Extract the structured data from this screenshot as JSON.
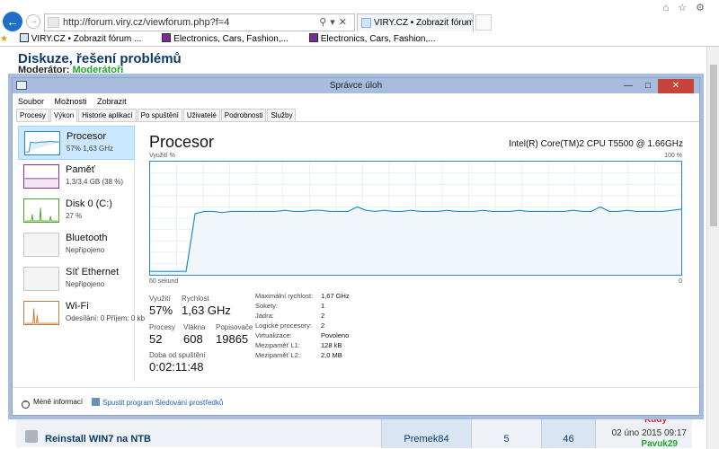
{
  "browser": {
    "url": "http://forum.viry.cz/viewforum.php?f=4",
    "tab_title": "VIRY.CZ • Zobrazit fórum - ...",
    "favorites": [
      "VIRY.CZ • Zobrazit fórum ...",
      "Electronics, Cars, Fashion,...",
      "Electronics, Cars, Fashion,..."
    ]
  },
  "forum": {
    "title": "Diskuze, řešení problémů",
    "moderator_label": "Moderátor:",
    "moderator_name": "Moderátoři",
    "row": {
      "topic": "Reinstall WIN7 na NTB",
      "author": "Premek84",
      "replies": "5",
      "views": "46",
      "last_date": "02 úno 2015 09:17",
      "last_user": "Pavuk29",
      "prev_user": "Rudy"
    }
  },
  "taskmanager": {
    "title": "Správce úloh",
    "menu": [
      "Soubor",
      "Možnosti",
      "Zobrazit"
    ],
    "tabs": [
      "Procesy",
      "Výkon",
      "Historie aplikací",
      "Po spuštění",
      "Uživatelé",
      "Podrobnosti",
      "Služby"
    ],
    "active_tab": "Výkon",
    "sidebar": [
      {
        "name": "Procesor",
        "sub": "57% 1,63 GHz"
      },
      {
        "name": "Paměť",
        "sub": "1,3/3,4 GB (38 %)"
      },
      {
        "name": "Disk 0 (C:)",
        "sub": "27 %"
      },
      {
        "name": "Bluetooth",
        "sub": "Nepřipojeno"
      },
      {
        "name": "Síť Ethernet",
        "sub": "Nepřipojeno"
      },
      {
        "name": "Wi-Fi",
        "sub": "Odesílání: 0 Příjem: 0 kb"
      }
    ],
    "main": {
      "heading": "Procesor",
      "cpu": "Intel(R) Core(TM)2 CPU T5500 @ 1.66GHz",
      "axis_top_left": "Využití %",
      "axis_top_right": "100 %",
      "axis_bottom_left": "60 sekund",
      "axis_bottom_right": "0",
      "stats": {
        "util_label": "Využití",
        "util_value": "57%",
        "speed_label": "Rychlost",
        "speed_value": "1,63 GHz",
        "proc_label": "Procesy",
        "proc_value": "52",
        "thr_label": "Vlákna",
        "thr_value": "608",
        "handles_label": "Popisovače",
        "handles_value": "19865",
        "uptime_label": "Doba od spuštění",
        "uptime_value": "0:02:11:48"
      },
      "details": [
        {
          "k": "Maximální rychlost:",
          "v": "1,67 GHz"
        },
        {
          "k": "Sokety:",
          "v": "1"
        },
        {
          "k": "Jádra:",
          "v": "2"
        },
        {
          "k": "Logické procesory:",
          "v": "2"
        },
        {
          "k": "Virtualizace:",
          "v": "Povoleno"
        },
        {
          "k": "Mezipaměť L1:",
          "v": "128 kB"
        },
        {
          "k": "Mezipaměť L2:",
          "v": "2,0 MB"
        }
      ]
    },
    "footer": {
      "fewer": "Méně informací",
      "resmon": "Spustit program Sledování prostředků"
    },
    "cpu_history": [
      3,
      3,
      3,
      3,
      3,
      54,
      56,
      56,
      55,
      56,
      56,
      56,
      56,
      56,
      56,
      57,
      56,
      56,
      57,
      57,
      56,
      56,
      56,
      60,
      57,
      56,
      57,
      56,
      56,
      57,
      56,
      56,
      56,
      57,
      56,
      56,
      56,
      57,
      56,
      56,
      56,
      57,
      56,
      56,
      56,
      56,
      56,
      57,
      56,
      56,
      60,
      56,
      56,
      57,
      56,
      56,
      56,
      56,
      57,
      58
    ],
    "colors": {
      "accent": "#1c8ccd",
      "fill": "#f1f6fb",
      "sel": "#cce8ff"
    }
  }
}
